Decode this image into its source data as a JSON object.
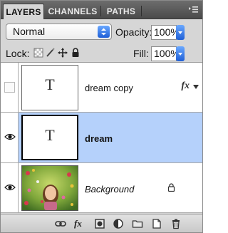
{
  "tabs": [
    {
      "label": "LAYERS",
      "active": true
    },
    {
      "label": "CHANNELS",
      "active": false
    },
    {
      "label": "PATHS",
      "active": false
    }
  ],
  "blend_mode": {
    "value": "Normal"
  },
  "opacity": {
    "label": "Opacity:",
    "value": "100%"
  },
  "lock": {
    "label": "Lock:"
  },
  "fill": {
    "label": "Fill:",
    "value": "100%"
  },
  "layers": [
    {
      "name": "dream copy",
      "type": "text",
      "thumb_glyph": "T",
      "visible": false,
      "selected": false,
      "effects": "fx"
    },
    {
      "name": "dream",
      "type": "text",
      "thumb_glyph": "T",
      "visible": true,
      "selected": true
    },
    {
      "name": "Background",
      "type": "image",
      "visible": true,
      "selected": false,
      "locked": true
    }
  ],
  "toolbar": {
    "fx_label": "fx"
  },
  "colors": {
    "selection": "#b5d1fb",
    "accent_blue": "#2a6de0",
    "panel_bg": "#d6d6d6"
  },
  "icons": [
    "link-layers-icon",
    "fx-icon",
    "layer-mask-icon",
    "adjustment-layer-icon",
    "new-group-icon",
    "new-layer-icon",
    "trash-icon"
  ]
}
